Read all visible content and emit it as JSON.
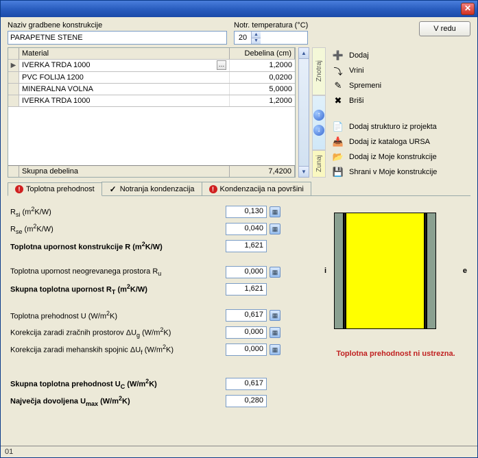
{
  "header": {
    "name_label": "Naziv gradbene konstrukcije",
    "name_value": "PARAPETNE STENE",
    "temp_label": "Notr. temperatura (°C)",
    "temp_value": "20",
    "ok_button": "V redu"
  },
  "grid": {
    "col_material": "Material",
    "col_thickness": "Debelina (cm)",
    "rows": [
      {
        "material": "IVERKA TRDA 1000",
        "thickness": "1,2000"
      },
      {
        "material": "PVC FOLIJA 1200",
        "thickness": "0,0200"
      },
      {
        "material": "MINERALNA VOLNA",
        "thickness": "5,0000"
      },
      {
        "material": "IVERKA TRDA 1000",
        "thickness": "1,2000"
      }
    ],
    "total_label": "Skupna debelina",
    "total_value": "7,4200"
  },
  "orient": {
    "inside": "Znotraj",
    "outside": "Zunaj"
  },
  "actions": {
    "add": "Dodaj",
    "insert": "Vrini",
    "change": "Spremeni",
    "delete": "Briši",
    "add_project": "Dodaj strukturo iz projekta",
    "add_ursa": "Dodaj iz kataloga URSA",
    "add_my": "Dodaj iz Moje konstrukcije",
    "save_my": "Shrani v Moje konstrukcije"
  },
  "tabs": {
    "t1": "Toplotna prehodnost",
    "t2": "Notranja kondenzacija",
    "t3": "Kondenzacija na površini"
  },
  "results": {
    "rsi_label": "R<sub>si</sub> (m<sup>2</sup>K/W)",
    "rsi_value": "0,130",
    "rse_label": "R<sub>se</sub> (m<sup>2</sup>K/W)",
    "rse_value": "0,040",
    "r_label": "Toplotna upornost konstrukcije R (m<sup>2</sup>K/W)",
    "r_value": "1,621",
    "ru_label": "Toplotna upornost neogrevanega prostora R<sub>u</sub>",
    "ru_value": "0,000",
    "rt_label": "Skupna toplotna upornost R<sub>T</sub> (m<sup>2</sup>K/W)",
    "rt_value": "1,621",
    "u_label": "Toplotna prehodnost  U (W/m<sup>2</sup>K)",
    "u_value": "0,617",
    "dug_label": "Korekcija zaradi zračnih prostorov ΔU<sub>g</sub> (W/m<sup>2</sup>K)",
    "dug_value": "0,000",
    "duf_label": "Korekcija zaradi mehanskih spojnic ΔU<sub>f</sub> (W/m<sup>2</sup>K)",
    "duf_value": "0,000",
    "uc_label": "Skupna toplotna prehodnost U<sub>C</sub> (W/m<sup>2</sup>K)",
    "uc_value": "0,617",
    "umax_label": "Največja dovoljena U<sub>max</sub> (W/m<sup>2</sup>K)",
    "umax_value": "0,280"
  },
  "diagram": {
    "inside_label": "i",
    "outside_label": "e",
    "layers": [
      {
        "width": 14,
        "color": "#8aa090"
      },
      {
        "width": 3,
        "color": "#303030"
      },
      {
        "width": 115,
        "color": "#ffff00"
      },
      {
        "width": 3,
        "color": "#303030"
      },
      {
        "width": 14,
        "color": "#8aa090"
      }
    ]
  },
  "warning": "Toplotna prehodnost ni ustrezna.",
  "status": "01"
}
